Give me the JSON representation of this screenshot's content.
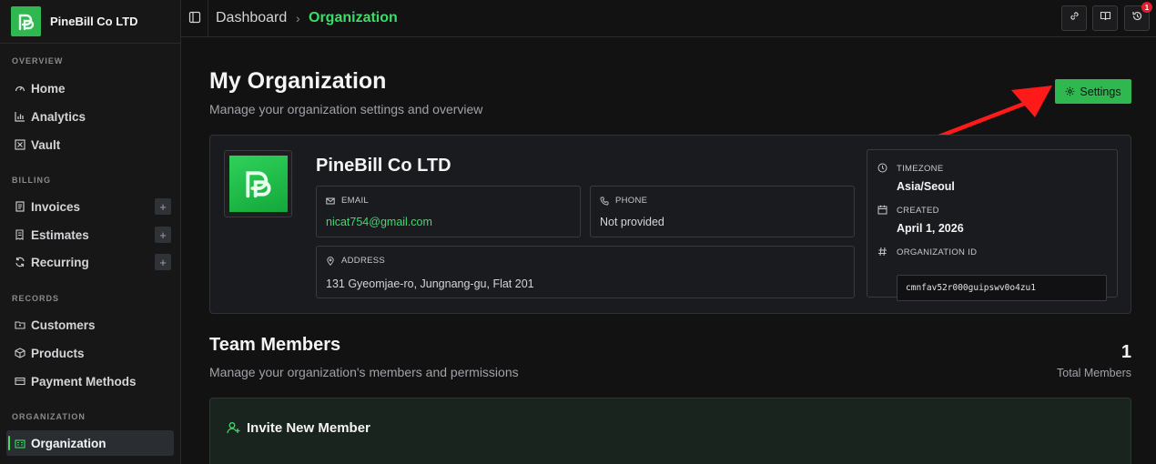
{
  "brand": {
    "name": "PineBill Co LTD"
  },
  "sidebar": {
    "sections": {
      "overview": "OVERVIEW",
      "billing": "BILLING",
      "records": "RECORDS",
      "organization": "ORGANIZATION"
    },
    "items": {
      "home": "Home",
      "analytics": "Analytics",
      "vault": "Vault",
      "invoices": "Invoices",
      "estimates": "Estimates",
      "recurring": "Recurring",
      "customers": "Customers",
      "products": "Products",
      "payment_methods": "Payment Methods",
      "organization": "Organization"
    },
    "plus": "+"
  },
  "topbar": {
    "breadcrumb_root": "Dashboard",
    "breadcrumb_sep": "›",
    "breadcrumb_current": "Organization",
    "notification_count": "1"
  },
  "main": {
    "title": "My Organization",
    "subtitle": "Manage your organization settings and overview",
    "settings_label": "Settings"
  },
  "org": {
    "name": "PineBill Co LTD",
    "email_label": "EMAIL",
    "email": "nicat754@gmail.com",
    "phone_label": "PHONE",
    "phone": "Not provided",
    "address_label": "ADDRESS",
    "address": "131 Gyeomjae-ro, Jungnang-gu, Flat 201",
    "timezone_label": "TIMEZONE",
    "timezone": "Asia/Seoul",
    "created_label": "CREATED",
    "created": "April 1, 2026",
    "org_id_label": "ORGANIZATION ID",
    "org_id": "cmnfav52r000guipswv0o4zu1"
  },
  "team": {
    "title": "Team Members",
    "subtitle": "Manage your organization's members and permissions",
    "count": "1",
    "count_label": "Total Members",
    "invite_title": "Invite New Member"
  },
  "colors": {
    "accent": "#3ddc6a",
    "button": "#2fb84f",
    "annotation_arrow": "#ff1a1a"
  }
}
